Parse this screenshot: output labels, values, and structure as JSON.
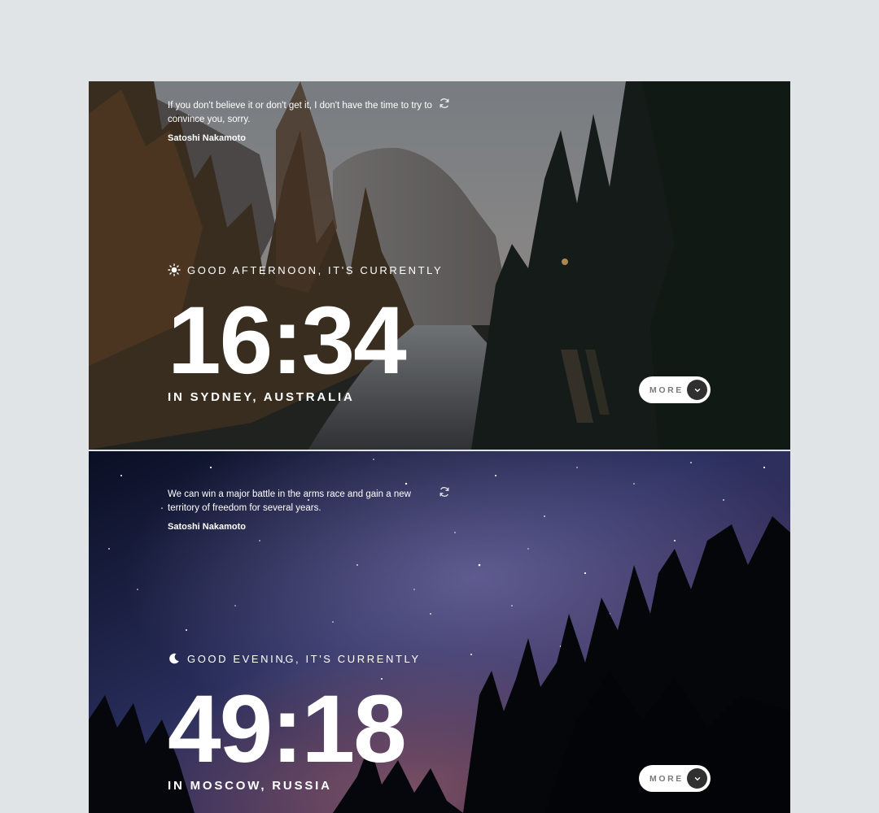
{
  "panels": [
    {
      "theme": "day",
      "quote": "If you don't believe it or don't get it, I don't have the time to try to convince you, sorry.",
      "author": "Satoshi Nakamoto",
      "greeting_icon": "sun-icon",
      "greeting": "GOOD AFTERNOON, IT'S CURRENTLY",
      "time": "16:34",
      "location": "IN SYDNEY, AUSTRALIA",
      "more_label": "MORE"
    },
    {
      "theme": "night",
      "quote": "We can win a major battle in the arms race and gain a new territory of freedom for several years.",
      "author": "Satoshi Nakamoto",
      "greeting_icon": "moon-icon",
      "greeting": "GOOD EVENING, IT'S CURRENTLY",
      "time": "49:18",
      "location": "IN MOSCOW, RUSSIA",
      "more_label": "MORE"
    }
  ],
  "colors": {
    "page_background": "#e0e4e7",
    "button_background": "#ffffff",
    "button_text": "#7a7a7a",
    "chevron_circle": "#303030"
  }
}
